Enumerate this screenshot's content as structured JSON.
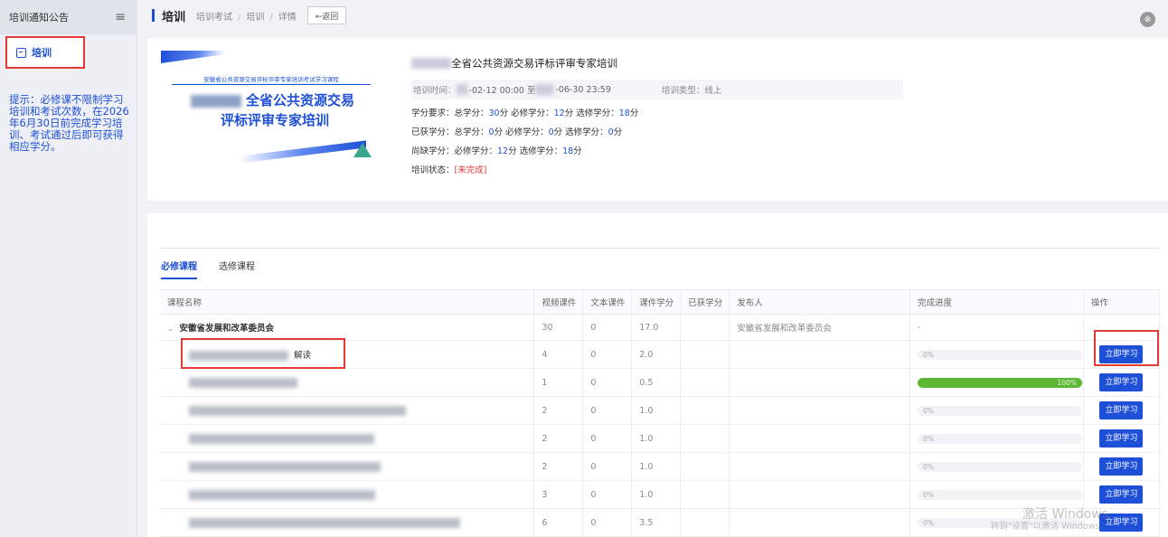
{
  "sidebar": {
    "header": "培训通知公告",
    "menu_icon": "≡",
    "item_label": "培训",
    "tip": "提示：必修课不限制学习培训和考试次数，在2026年6月30日前完成学习培训、考试通过后即可获得相应学分。"
  },
  "topbar": {
    "title": "培训",
    "crumb1": "培训考试",
    "crumb2": "培训",
    "crumb3": "详情",
    "back": "←返回",
    "avatar": "⊗"
  },
  "banner": {
    "subtitle": "安徽省公共资源交易评标评审专家培训考试学习课程",
    "line1": "全省公共资源交易",
    "line2": "评标评审专家培训"
  },
  "info": {
    "title": "全省公共资源交易评标评审专家培训",
    "time_label": "培训时间：",
    "time_start": "-02-12 00:00 至",
    "time_end": "-06-30 23:59",
    "type_label": "培训类型：线上",
    "req_prefix": "学分要求：总学分：",
    "req_total": "30",
    "req_mid1": "分 必修学分：",
    "req_required": "12",
    "req_mid2": "分 选修学分：",
    "req_elective": "18",
    "req_suffix": "分",
    "got_prefix": "已获学分：总学分：",
    "got_total": "0",
    "got_mid1": "分 必修学分：",
    "got_required": "0",
    "got_mid2": "分 选修学分：",
    "got_elective": "0",
    "got_suffix": "分",
    "lack_prefix": "尚缺学分：必修学分：",
    "lack_required": "12",
    "lack_mid": "分 选修学分：",
    "lack_elective": "18",
    "lack_suffix": "分",
    "status_label": "培训状态：",
    "status_value": "[未完成]"
  },
  "tabs": [
    "必修课程",
    "选修课程"
  ],
  "table": {
    "headers": [
      "课程名称",
      "视频课件",
      "文本课件",
      "课件学分",
      "已获学分",
      "发布人",
      "完成进度",
      "操作"
    ],
    "group": {
      "name": "安徽省发展和改革委员会",
      "video": "30",
      "text": "0",
      "credit": "17.0",
      "publisher": "安徽省发展和改革委员会",
      "progress": "-"
    },
    "rows": [
      {
        "name": "解读",
        "video": "4",
        "text": "0",
        "credit": "2.0",
        "progress": "0%",
        "pct": 0,
        "action": "立即学习"
      },
      {
        "name": "",
        "video": "1",
        "text": "0",
        "credit": "0.5",
        "progress": "100%",
        "pct": 100,
        "action": "立即学习"
      },
      {
        "name": "",
        "video": "2",
        "text": "0",
        "credit": "1.0",
        "progress": "0%",
        "pct": 0,
        "action": "立即学习"
      },
      {
        "name": "",
        "video": "2",
        "text": "0",
        "credit": "1.0",
        "progress": "0%",
        "pct": 0,
        "action": "立即学习"
      },
      {
        "name": "",
        "video": "2",
        "text": "0",
        "credit": "1.0",
        "progress": "0%",
        "pct": 0,
        "action": "立即学习"
      },
      {
        "name": "",
        "video": "3",
        "text": "0",
        "credit": "1.0",
        "progress": "0%",
        "pct": 0,
        "action": "立即学习"
      },
      {
        "name": "",
        "video": "6",
        "text": "0",
        "credit": "3.5",
        "progress": "0%",
        "pct": 0,
        "action": "立即学习"
      }
    ]
  },
  "watermark": {
    "line1": "激活 Windows",
    "line2": "转到\"设置\"以激活 Windows。"
  },
  "colors": {
    "accent": "#1e4fd7",
    "danger": "#e53935",
    "success": "#5cb735"
  }
}
